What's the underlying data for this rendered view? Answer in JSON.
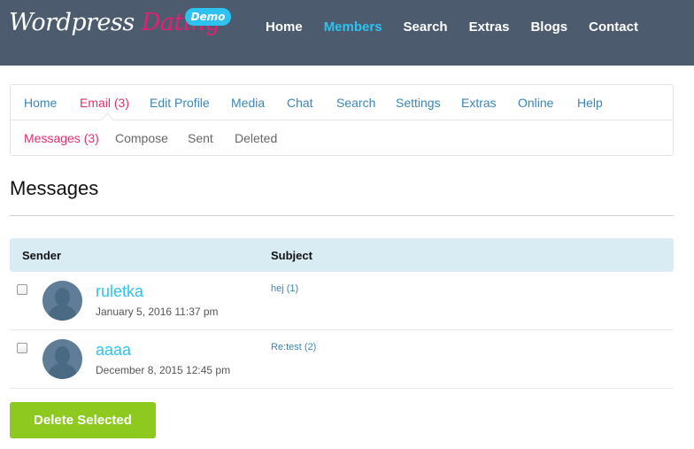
{
  "header": {
    "logo_word1": "Wordpress",
    "logo_word2": "Dating",
    "demo_badge": "Demo",
    "nav": [
      "Home",
      "Members",
      "Search",
      "Extras",
      "Blogs",
      "Contact"
    ],
    "active_nav": "Members"
  },
  "subnav": {
    "primary": [
      "Home",
      "Email (3)",
      "Edit Profile",
      "Media",
      "Chat",
      "Search",
      "Settings",
      "Extras",
      "Online",
      "Help"
    ],
    "primary_active": "Email (3)",
    "secondary": [
      "Messages (3)",
      "Compose",
      "Sent",
      "Deleted"
    ],
    "secondary_active": "Messages (3)"
  },
  "page": {
    "title": "Messages"
  },
  "table": {
    "headers": [
      "Sender",
      "Subject"
    ],
    "rows": [
      {
        "sender": "ruletka",
        "date": "January 5, 2016 11:37 pm",
        "subject": "hej (1)"
      },
      {
        "sender": "aaaa",
        "date": "December 8, 2015 12:45 pm",
        "subject": "Re:test (2)"
      }
    ]
  },
  "actions": {
    "delete_selected": "Delete Selected"
  },
  "colors": {
    "header_bg": "#4c5b6e",
    "accent_blue": "#2ec2f0",
    "accent_pink": "#e91e72",
    "link_blue": "#3a86b7",
    "button_green": "#8ec920",
    "table_header_bg": "#d9ecf4"
  },
  "icons": {
    "avatar": "default-user-silhouette-icon",
    "checkbox": "checkbox-icon"
  }
}
